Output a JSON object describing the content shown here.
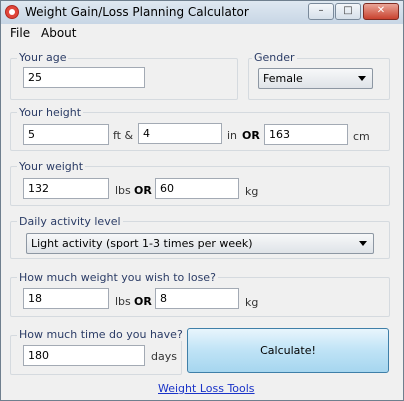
{
  "window": {
    "title": "Weight Gain/Loss Planning Calculator",
    "minimize_icon": "minimize-icon",
    "maximize_icon": "maximize-icon",
    "close_icon": "close-icon"
  },
  "menu": {
    "file": "File",
    "about": "About"
  },
  "age": {
    "label": "Your age",
    "value": "25"
  },
  "gender": {
    "label": "Gender",
    "selected": "Female"
  },
  "height": {
    "label": "Your height",
    "feet": "5",
    "feet_unit": "ft &",
    "inches": "4",
    "inches_unit": "in",
    "or": "OR",
    "cm": "163",
    "cm_unit": "cm"
  },
  "weight": {
    "label": "Your weight",
    "lbs": "132",
    "lbs_unit": "lbs",
    "or": "OR",
    "kg": "60",
    "kg_unit": "kg"
  },
  "activity": {
    "label": "Daily activity level",
    "selected": "Light activity (sport 1-3 times per week)"
  },
  "lose": {
    "label": "How much weight you wish to lose?",
    "lbs": "18",
    "lbs_unit": "lbs",
    "or": "OR",
    "kg": "8",
    "kg_unit": "kg"
  },
  "time": {
    "label": "How much time do you have?",
    "value": "180",
    "unit": "days"
  },
  "calculate_label": "Calculate!",
  "footer_link": "Weight Loss Tools",
  "colors": {
    "group_label": "#2b3c66",
    "link": "#1a33c8",
    "close_button": "#c9422f"
  }
}
